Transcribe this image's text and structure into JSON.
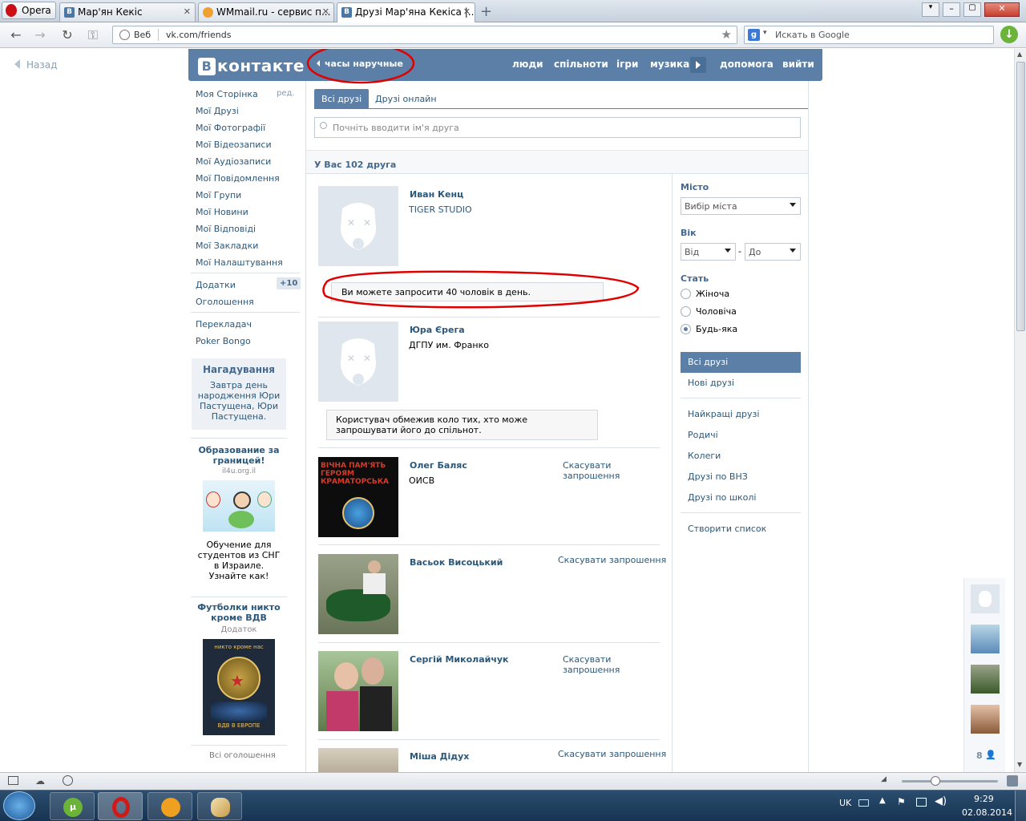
{
  "browser": {
    "opera_label": "Opera",
    "tabs": [
      {
        "label": "Мар'ян Кекіс"
      },
      {
        "label": "WMmail.ru - сервис п..."
      },
      {
        "label": "Друзі Мар'яна Кекіса |..."
      }
    ],
    "web_label": "Веб",
    "url": "vk.com/friends",
    "search_placeholder": "Искать в Google"
  },
  "vk": {
    "back_label": "Назад",
    "logo_text": "контакте",
    "status_text": "часы наручные",
    "nav": [
      "люди",
      "спільноти",
      "ігри",
      "музика",
      "допомога",
      "вийти"
    ],
    "left_menu": [
      "Моя Сторінка",
      "Мої Друзі",
      "Мої Фотографії",
      "Мої Відеозаписи",
      "Мої Аудіозаписи",
      "Мої Повідомлення",
      "Мої Групи",
      "Мої Новини",
      "Мої Відповіді",
      "Мої Закладки",
      "Мої Налаштування"
    ],
    "edit_label": "ред.",
    "apps_label": "Додатки",
    "apps_badge": "+10",
    "ads_label": "Оголошення",
    "translator_label": "Перекладач",
    "poker_label": "Poker Bongo",
    "reminder": {
      "title": "Нагадування",
      "line1": "Завтра день",
      "line2": "народження Юри",
      "line3": "Пастущена, Юри",
      "line4": "Пастущена."
    },
    "ad1": {
      "title": "Образование за границей!",
      "domain": "il4u.org.il",
      "text": "Обучение для студентов из СНГ в Израиле. Узнайте как!"
    },
    "ad2": {
      "title": "Футболки никто кроме ВДВ",
      "sub": "Додаток",
      "badge_top": "никто кроме нас",
      "badge_bottom": "ВДВ В ЕВРОПЕ"
    },
    "all_ads_label": "Всі оголошення",
    "tabs": {
      "all": "Всі друзі",
      "online": "Друзі онлайн"
    },
    "search_placeholder": "Почніть вводити ім'я друга",
    "count_label": "У Вас 102 друга",
    "friends": [
      {
        "name": "Иван Кенц",
        "info": "TIGER STUDIO",
        "note": "Ви можете запросити 40 чоловік в день."
      },
      {
        "name": "Юра Єрега",
        "info": "ДГПУ им. Франко",
        "note": "Користувач обмежив коло тих, хто може запрошувати його до спільнот."
      },
      {
        "name": "Олег Баляс",
        "info": "ОИСВ",
        "action": "Скасувати запрошення",
        "img_text": "ВІЧНА ПАМ'ЯТЬ ГЕРОЯМ КРАМАТОРСЬКА"
      },
      {
        "name": "Васьок Висоцький",
        "action": "Скасувати запрошення"
      },
      {
        "name": "Сергій Миколайчук",
        "action": "Скасувати запрошення"
      },
      {
        "name": "Міша Дідух",
        "action": "Скасувати запрошення"
      }
    ],
    "filters": {
      "city_label": "Місто",
      "city_value": "Вибір міста",
      "age_label": "Вік",
      "age_from": "Від",
      "age_dash": "-",
      "age_to": "До",
      "gender_label": "Стать",
      "genders": [
        "Жіноча",
        "Чоловіча",
        "Будь-яка"
      ],
      "gender_selected": 2
    },
    "right_lists": [
      "Всі друзі",
      "Нові друзі",
      "Найкращі друзі",
      "Родичі",
      "Колеги",
      "Друзі по ВНЗ",
      "Друзі по школі",
      "Створити список"
    ],
    "online_count": "8"
  },
  "taskbar": {
    "lang": "UK",
    "time": "9:29",
    "date": "02.08.2014"
  },
  "colors": {
    "vk_blue": "#5b7fa6",
    "link": "#2b587a",
    "annotation_red": "#e00000"
  }
}
